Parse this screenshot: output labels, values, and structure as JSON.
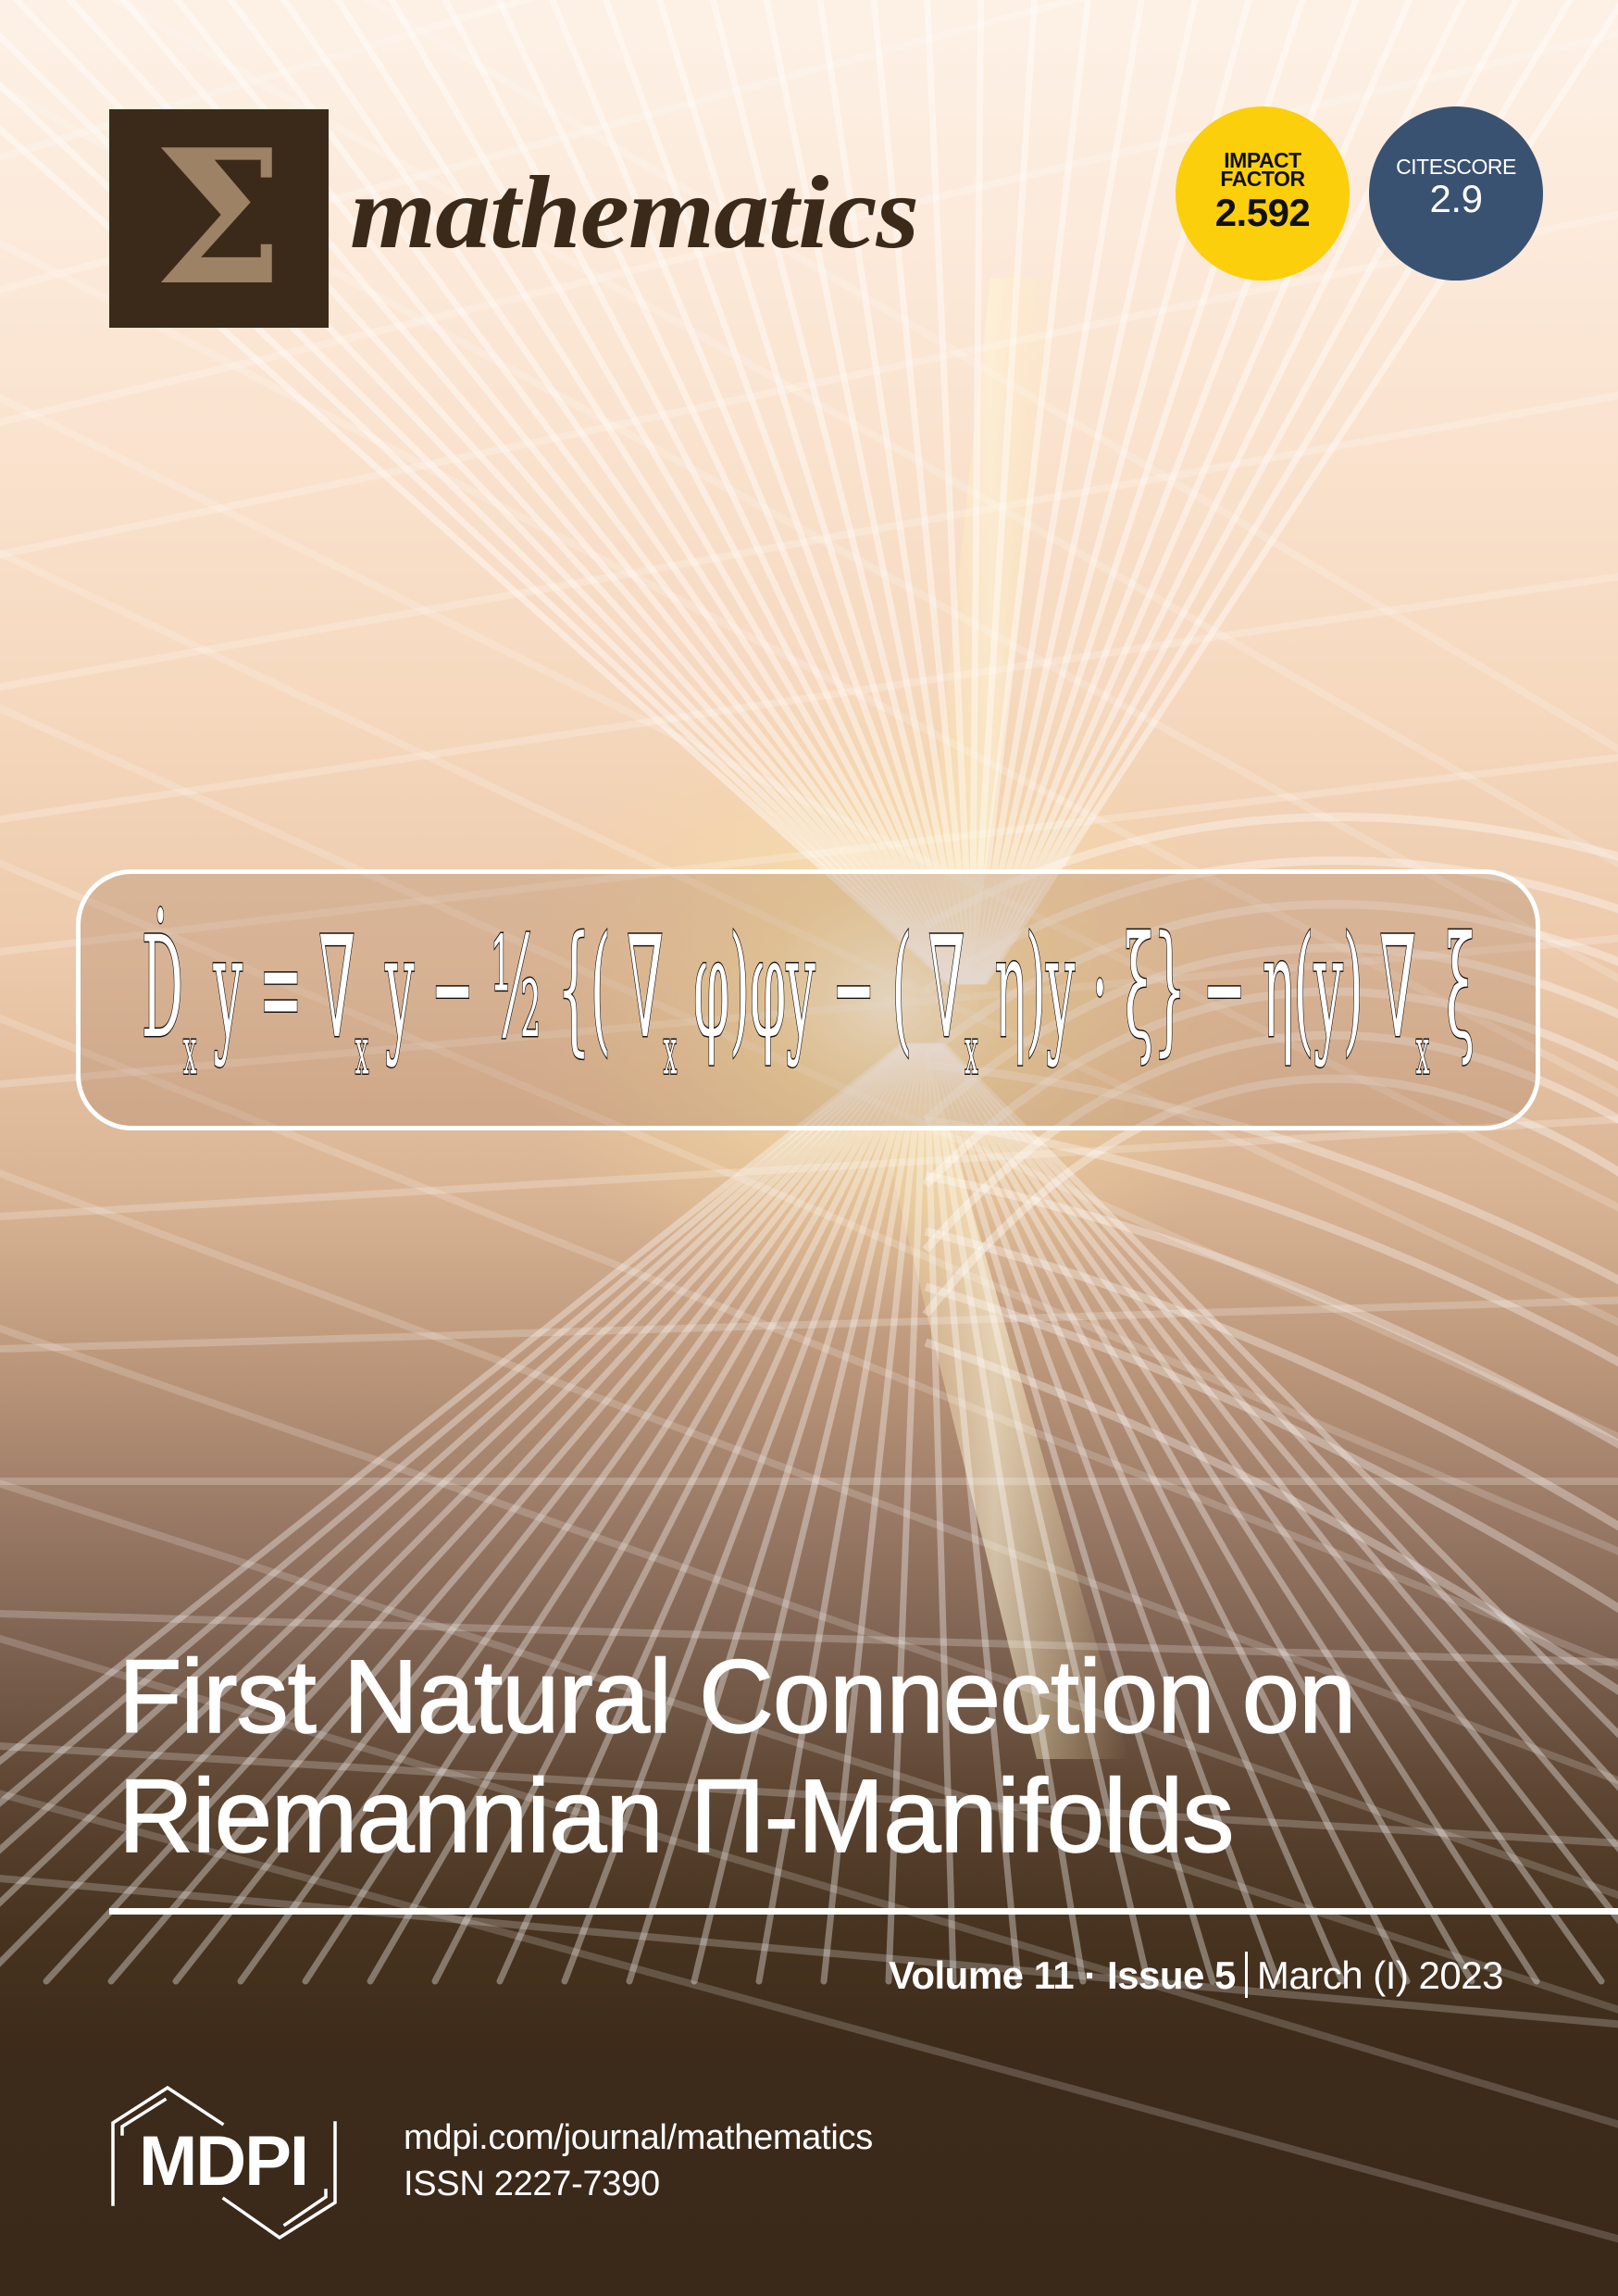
{
  "journal": {
    "logo_symbol": "Σ",
    "name": "mathematics",
    "brand_color": "#3b2a19",
    "logo_symbol_color": "#9e8266"
  },
  "badges": [
    {
      "label_lines": [
        "IMPACT",
        "FACTOR"
      ],
      "value": "2.592",
      "color": "#fccf0c",
      "icon": "impact-factor-badge"
    },
    {
      "label_lines": [
        "CITESCORE"
      ],
      "value": "2.9",
      "color": "#3a5272",
      "icon": "citescore-badge"
    }
  ],
  "cover_art": {
    "formula": "Ḋₓy = ∇ₓy − ½{(∇ₓφ)φy − (∇ₓη)y · ξ} − η(y)∇ₓξ",
    "formula_parts": [
      {
        "t": "Ḋ"
      },
      {
        "t": "x",
        "sub": true
      },
      {
        "t": "y"
      },
      {
        "t": "="
      },
      {
        "t": "∇"
      },
      {
        "t": "x",
        "sub": true
      },
      {
        "t": "y"
      },
      {
        "t": "−"
      },
      {
        "t": "½"
      },
      {
        "t": "{("
      },
      {
        "t": "∇"
      },
      {
        "t": "x",
        "sub": true
      },
      {
        "t": "φ)φy"
      },
      {
        "t": "−"
      },
      {
        "t": "("
      },
      {
        "t": "∇"
      },
      {
        "t": "x",
        "sub": true
      },
      {
        "t": "η)y"
      },
      {
        "t": "·"
      },
      {
        "t": "ξ}"
      },
      {
        "t": "−"
      },
      {
        "t": "η(y)"
      },
      {
        "t": "∇"
      },
      {
        "t": "x",
        "sub": true
      },
      {
        "t": "ξ"
      }
    ]
  },
  "article": {
    "title_lines": [
      "First Natural Connection on",
      "Riemannian Π-Manifolds"
    ]
  },
  "issue": {
    "volume": "Volume 11",
    "bullet": "·",
    "issue": "Issue 5",
    "date": "March (I) 2023"
  },
  "publisher": {
    "logo_text": "MDPI",
    "url": "mdpi.com/journal/mathematics",
    "issn": "ISSN 2227-7390"
  },
  "colors": {
    "background_top": "#fdf1e6",
    "background_bottom": "#3a2819",
    "text_light": "#ffffff"
  }
}
